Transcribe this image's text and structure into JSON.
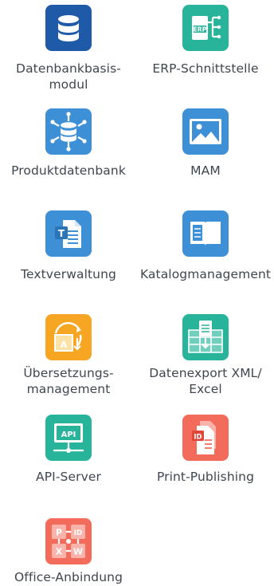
{
  "modules": [
    {
      "label": "Datenbankbasis-\nmodul",
      "icon": "database-icon",
      "color": "#1e5aa8"
    },
    {
      "label": "ERP-Schnittstelle",
      "icon": "erp-interface-icon",
      "color": "#27b49a",
      "icon_text": "ERP"
    },
    {
      "label": "Produktdatenbank",
      "icon": "product-database-icon",
      "color": "#3d8fd6"
    },
    {
      "label": "MAM",
      "icon": "image-asset-icon",
      "color": "#3d8fd6"
    },
    {
      "label": "Textverwaltung",
      "icon": "text-document-icon",
      "color": "#3d8fd6",
      "icon_text": "T"
    },
    {
      "label": "Katalogmanagement",
      "icon": "catalog-book-icon",
      "color": "#3d8fd6"
    },
    {
      "label": "Übersetzungs-\nmanagement",
      "icon": "translation-icon",
      "color": "#f6a623",
      "icon_text": "A"
    },
    {
      "label": "Datenexport XML/\nExcel",
      "icon": "data-export-icon",
      "color": "#27b49a"
    },
    {
      "label": "API-Server",
      "icon": "api-server-icon",
      "color": "#27b49a",
      "icon_text": "API"
    },
    {
      "label": "Print-Publishing",
      "icon": "print-publishing-icon",
      "color": "#f26b5b",
      "icon_text": "ID"
    },
    {
      "label": "Office-Anbindung",
      "icon": "office-connection-icon",
      "color": "#f26b5b",
      "icon_text": [
        "P",
        "ID",
        "X",
        "W"
      ]
    }
  ]
}
